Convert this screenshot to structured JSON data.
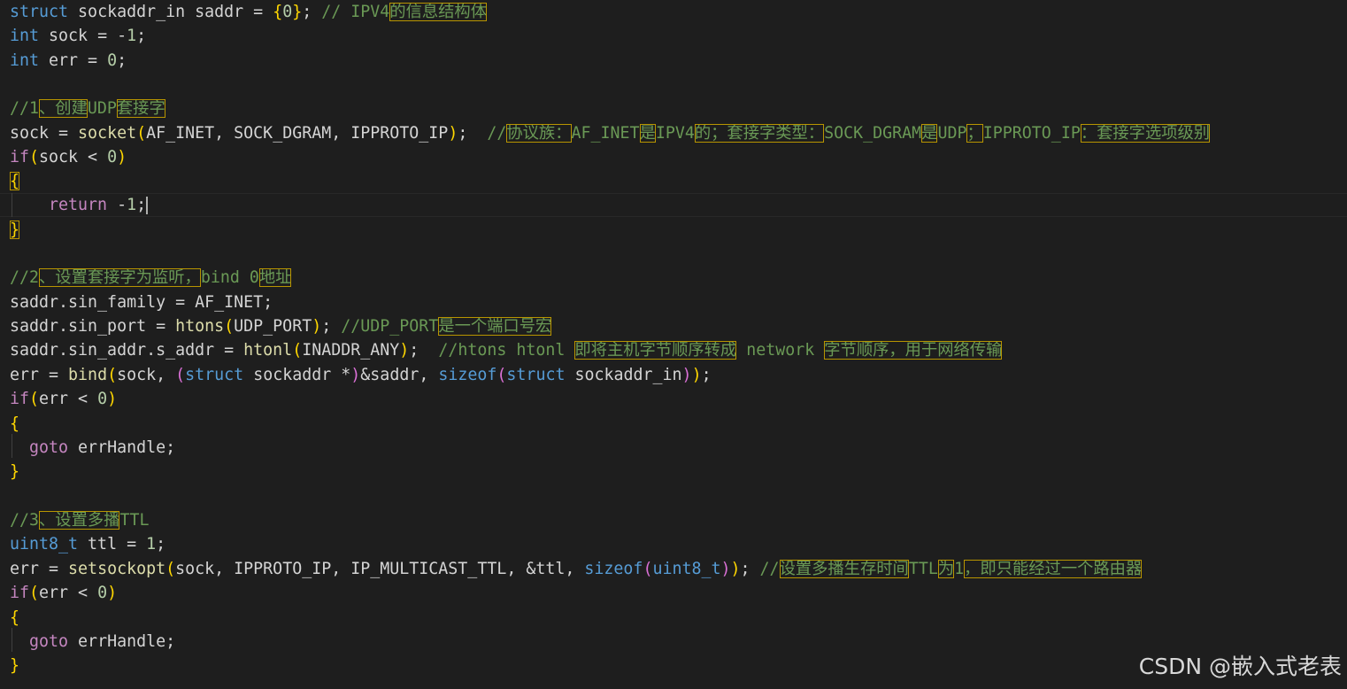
{
  "editor": {
    "colors": {
      "background": "#1e1e1e",
      "keyword": "#569cd6",
      "control": "#c586c0",
      "function": "#dcdcaa",
      "comment": "#6a9955",
      "bracket": "#ffd700",
      "highlight_box": "#b89500"
    },
    "lines": {
      "l1": {
        "kw": "struct",
        "t1": " sockaddr_in saddr = ",
        "b1": "{",
        "n": "0",
        "b2": "}",
        "t2": "; ",
        "c1": "// IPV4",
        "c2": "的信息结构体"
      },
      "l2": {
        "kw": "int",
        "t1": " sock = -",
        "n": "1",
        "t2": ";"
      },
      "l3": {
        "kw": "int",
        "t1": " err = ",
        "n": "0",
        "t2": ";"
      },
      "l5": {
        "c1": "//1",
        "c2": "、创建",
        "c3": "UDP",
        "c4": "套接字"
      },
      "l6": {
        "t1": "sock = ",
        "fn": "socket",
        "b1": "(",
        "t2": "AF_INET, SOCK_DGRAM, IPPROTO_IP",
        "b2": ")",
        "t3": ";  ",
        "c1": "//",
        "c2": "协议族：",
        "c3": "AF_INET",
        "c4": "是",
        "c5": "IPV4",
        "c6": "的；套接字类型：",
        "c7": "SOCK_DGRAM",
        "c8": "是",
        "c9": "UDP",
        "c10": "；",
        "c11": "IPPROTO_IP",
        "c12": "：套接字选项级别"
      },
      "l7": {
        "ctl": "if",
        "b1": "(",
        "t1": "sock < ",
        "n": "0",
        "b2": ")"
      },
      "l8": {
        "b1": "{"
      },
      "l9": {
        "indent": "    ",
        "ctl": "return",
        "t1": " -",
        "n": "1",
        "t2": ";"
      },
      "l10": {
        "b1": "}"
      },
      "l12": {
        "c1": "//2",
        "c2": "、设置套接字为监听，",
        "c3": "bind 0",
        "c4": "地址"
      },
      "l13": {
        "t1": "saddr.sin_family = AF_INET;"
      },
      "l14": {
        "t1": "saddr.sin_port = ",
        "fn": "htons",
        "b1": "(",
        "t2": "UDP_PORT",
        "b2": ")",
        "t3": "; ",
        "c1": "//UDP_PORT",
        "c2": "是一个端口号宏"
      },
      "l15": {
        "t1": "saddr.sin_addr.s_addr = ",
        "fn": "htonl",
        "b1": "(",
        "t2": "INADDR_ANY",
        "b2": ")",
        "t3": ";  ",
        "c1": "//htons htonl ",
        "c2": "即将主机字节顺序转成",
        "c3": " network ",
        "c4": "字节顺序，用于网络传输"
      },
      "l16": {
        "t1": "err = ",
        "fn": "bind",
        "b1": "(",
        "t2": "sock, ",
        "b2": "(",
        "kw": "struct",
        "t3": " sockaddr *",
        "b3": ")",
        "t4": "&saddr, ",
        "fn2": "sizeof",
        "b4": "(",
        "kw2": "struct",
        "t5": " sockaddr_in",
        "b5": ")",
        "b6": ")",
        "t6": ";"
      },
      "l17": {
        "ctl": "if",
        "b1": "(",
        "t1": "err < ",
        "n": "0",
        "b2": ")"
      },
      "l18": {
        "b1": "{"
      },
      "l19": {
        "indent": "  ",
        "ctl": "goto",
        "t1": " errHandle;"
      },
      "l20": {
        "b1": "}"
      },
      "l22": {
        "c1": "//3",
        "c2": "、设置多播",
        "c3": "TTL"
      },
      "l23": {
        "ty": "uint8_t",
        "t1": " ttl = ",
        "n": "1",
        "t2": ";"
      },
      "l24": {
        "t1": "err = ",
        "fn": "setsockopt",
        "b1": "(",
        "t2": "sock, IPPROTO_IP, IP_MULTICAST_TTL, &ttl, ",
        "fn2": "sizeof",
        "b2": "(",
        "ty": "uint8_t",
        "b3": ")",
        "b4": ")",
        "t3": "; ",
        "c1": "//",
        "c2": "设置多播生存时间",
        "c3": "TTL",
        "c4": "为",
        "c5": "1",
        "c6": "，即只能经过一个路由器"
      },
      "l25": {
        "ctl": "if",
        "b1": "(",
        "t1": "err < ",
        "n": "0",
        "b2": ")"
      },
      "l26": {
        "b1": "{"
      },
      "l27": {
        "indent": "  ",
        "ctl": "goto",
        "t1": " errHandle;"
      },
      "l28": {
        "b1": "}"
      }
    }
  },
  "watermark": "CSDN @嵌入式老表"
}
